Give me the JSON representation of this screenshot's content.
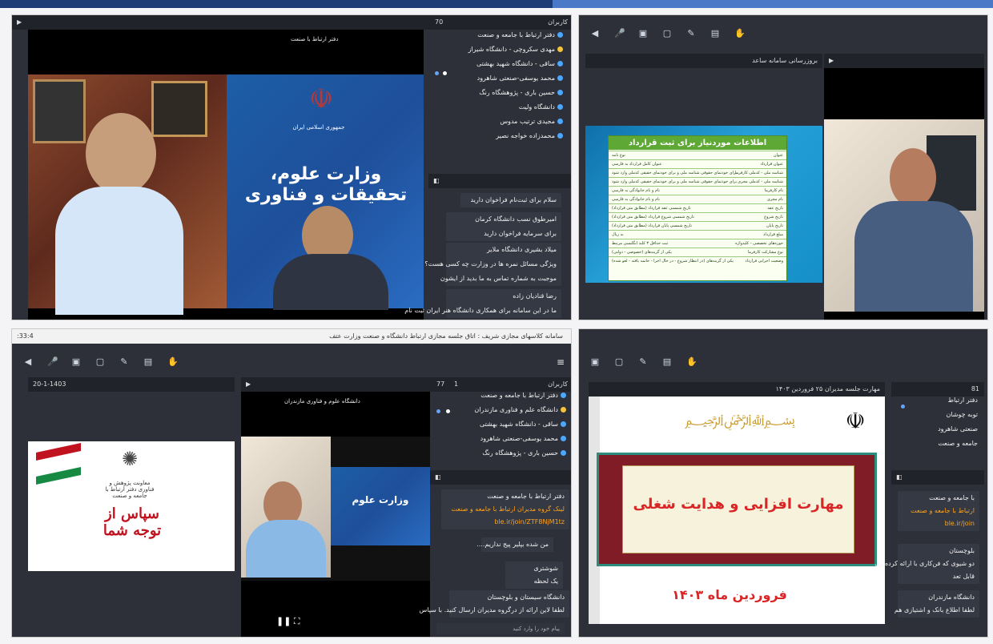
{
  "windows": [
    {
      "participants_count": "70",
      "participants_title": "کاربران",
      "video_title": "دفتر ارتباط با صنعت",
      "users": [
        "دفتر ارتباط با جامعه و صنعت",
        "مهدی سکروچی - دانشگاه شیراز",
        "ساقی - دانشگاه شهید بهشتی",
        "محمد یوسفی-صنعتی شاهرود",
        "حسین باری - پژوهشگاه رنگ",
        "دانشگاه ولیت",
        "مجیدی ترتیب مدوس",
        "محمدزاده خواجه نصیر"
      ],
      "chat": [
        "سلام برای ثبت‌نام فراخوان دارید",
        "امیرطوق نسب دانشگاه کرمان",
        "برای سرمایه فراخوان دارید",
        "میلاد بشیری دانشگاه ملایر",
        "ویژگی مسائل نمره ها در وزارت چه کسی هست؟",
        "موجبت به شماره تماس به ما بدید از ایشون",
        "رضا قنادیان زاده",
        "ما در این سامانه برای همکاری دانشگاه هنر ایران ثبت نام"
      ],
      "emblem_text": "جمهوری اسلامی ایران",
      "banner_text": "وزارت علوم، تحقیقات و فناوری"
    },
    {
      "participants_title": "بروزرسانی سامانه ساعد",
      "slide_title": "اطلاعات موردنیاز برای ثبت قرارداد",
      "slide_rows": [
        [
          "نوع نامه",
          "عنوان"
        ],
        [
          "عنوان کامل قرارداد به فارسی",
          "عنوان قرارداد"
        ],
        [
          "برای خودنمای حقوقی شناسه ملی و برای خودنمای حقیقی کدملی وارد شود",
          "شناسه ملی - کدملی کارفرما"
        ],
        [
          "برای خودنمای حقوقی شناسه ملی و برای خودنمای حقیقی کدملی وارد شود",
          "شناسه ملی - کدملی مجری"
        ],
        [
          "نام و نام خانوادگی به فارسی",
          "نام کارفرما"
        ],
        [
          "نام و نام خانوادگی به فارسی",
          "نام مجری"
        ],
        [
          "تاریخ شمسی عقد قرارداد (مطابق متن قرارداد)",
          "تاریخ عقد"
        ],
        [
          "تاریخ شمسی شروع قرارداد (مطابق متن قرارداد)",
          "تاریخ شروع"
        ],
        [
          "تاریخ شمسی پایان قرارداد (مطابق متن قرارداد)",
          "تاریخ پایان"
        ],
        [
          "به ریال",
          "مبلغ قرارداد"
        ],
        [
          "ثبت حداقل ۳ کلید انگلیسی مرتبط",
          "حوزه‌های تخصصی - کلیدواژه"
        ],
        [
          "یکی از گزینه‌های (خصوصی - دولتی)",
          "نوع مشارکت کارفرما"
        ],
        [
          "یکی از گزینه‌های (در انتظار شروع - در حال اجرا - خاتمه یافته - لغو شده)",
          "وضعیت اجرایی قرارداد"
        ]
      ]
    },
    {
      "window_title": "سامانه کلاسهای مجازی شریف : اتاق جلسه مجازی ارتباط دانشگاه و صنعت وزارت عتف",
      "time_label": ":33:4",
      "slide_date": "20-1-1403",
      "participants_count": "77",
      "participants_online": "1",
      "participants_title": "کاربران",
      "video_title": "دانشگاه علوم و فناوری مازندران",
      "users": [
        "دفتر ارتباط با جامعه و صنعت",
        "دانشگاه علم و فناوری مازندران",
        "ساقی - دانشگاه شهید بهشتی",
        "محمد یوسفی-صنعتی شاهرود",
        "حسین باری - پژوهشگاه رنگ"
      ],
      "chat": [
        "دفتر ارتباط با جامعه و صنعت",
        "لینک گروه مدیران ارتباط با جامعه و صنعت",
        "ble.ir/join/ZTF8NjM1tz",
        "من شده بپلیر پیج نداریم....",
        "شوشتری",
        "یک لحظه",
        "دانشگاه سیستان و بلوچستان",
        "لطفا لاین ارائه از درگروه مدیران ارسال کنید. با سپاس"
      ],
      "input_placeholder": "پیام خود را وارد کنید",
      "slide_thanks": "سپاس از توجه شما",
      "slide_small_text": "معاونت پژوهش و فناوری دفتر ارتباط با جامعه و صنعت"
    },
    {
      "top_title": "مهارت جلسه مدیران ۲۵ فروردین ۱۴۰۳",
      "participants_count": "81",
      "slide_title": "مهارت افزایی و هدایت شغلی",
      "slide_date": "فروردین ماه ۱۴۰۳",
      "users": [
        "دفتر ارتباط",
        "توبه چوشان",
        "صنعتی شاهرود",
        "جامعه و صنعت"
      ],
      "chat": [
        "با جامعه و صنعت",
        "ارتباط با جامعه و صنعت",
        "ble.ir/join",
        "بلوچستان",
        "دو شیوی که فن‌کاری با ارائه کرده ری",
        "قابل تعد",
        "دانشگاه مازندران",
        "لطفا اطلاع بانک و اشتیازی هم"
      ]
    }
  ],
  "colors": {
    "top_bar": "#1d3b74",
    "panel_bg": "#24262d",
    "accent_blue": "#4ca7ff",
    "slide_green": "#5ea935",
    "slide_red": "#c1121f"
  }
}
